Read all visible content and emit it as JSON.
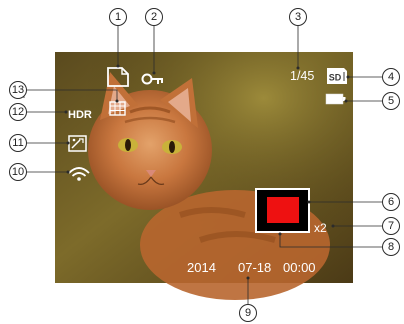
{
  "screen": {
    "photo_description_tag": "cat-photo",
    "image_count": "1/45",
    "memory_card_label": "SD",
    "date_year": "2014",
    "date_month_day": "07-18",
    "time": "00:00",
    "zoom_level": "x2",
    "hdr_label": "HDR"
  },
  "callouts": {
    "c1": "1",
    "c2": "2",
    "c3": "3",
    "c4": "4",
    "c5": "5",
    "c6": "6",
    "c7": "7",
    "c8": "8",
    "c9": "9",
    "c10": "10",
    "c11": "11",
    "c12": "12",
    "c13": "13"
  },
  "colors": {
    "zoom_window_fill": "#ee1111",
    "osd": "#ffffff",
    "callout_stroke": "#2b2b2b"
  },
  "icons": [
    "file-icon",
    "protect-key-icon",
    "grid-icon",
    "hdr-icon",
    "face-beauty-icon",
    "wifi-icon",
    "sd-card-icon",
    "battery-icon"
  ]
}
